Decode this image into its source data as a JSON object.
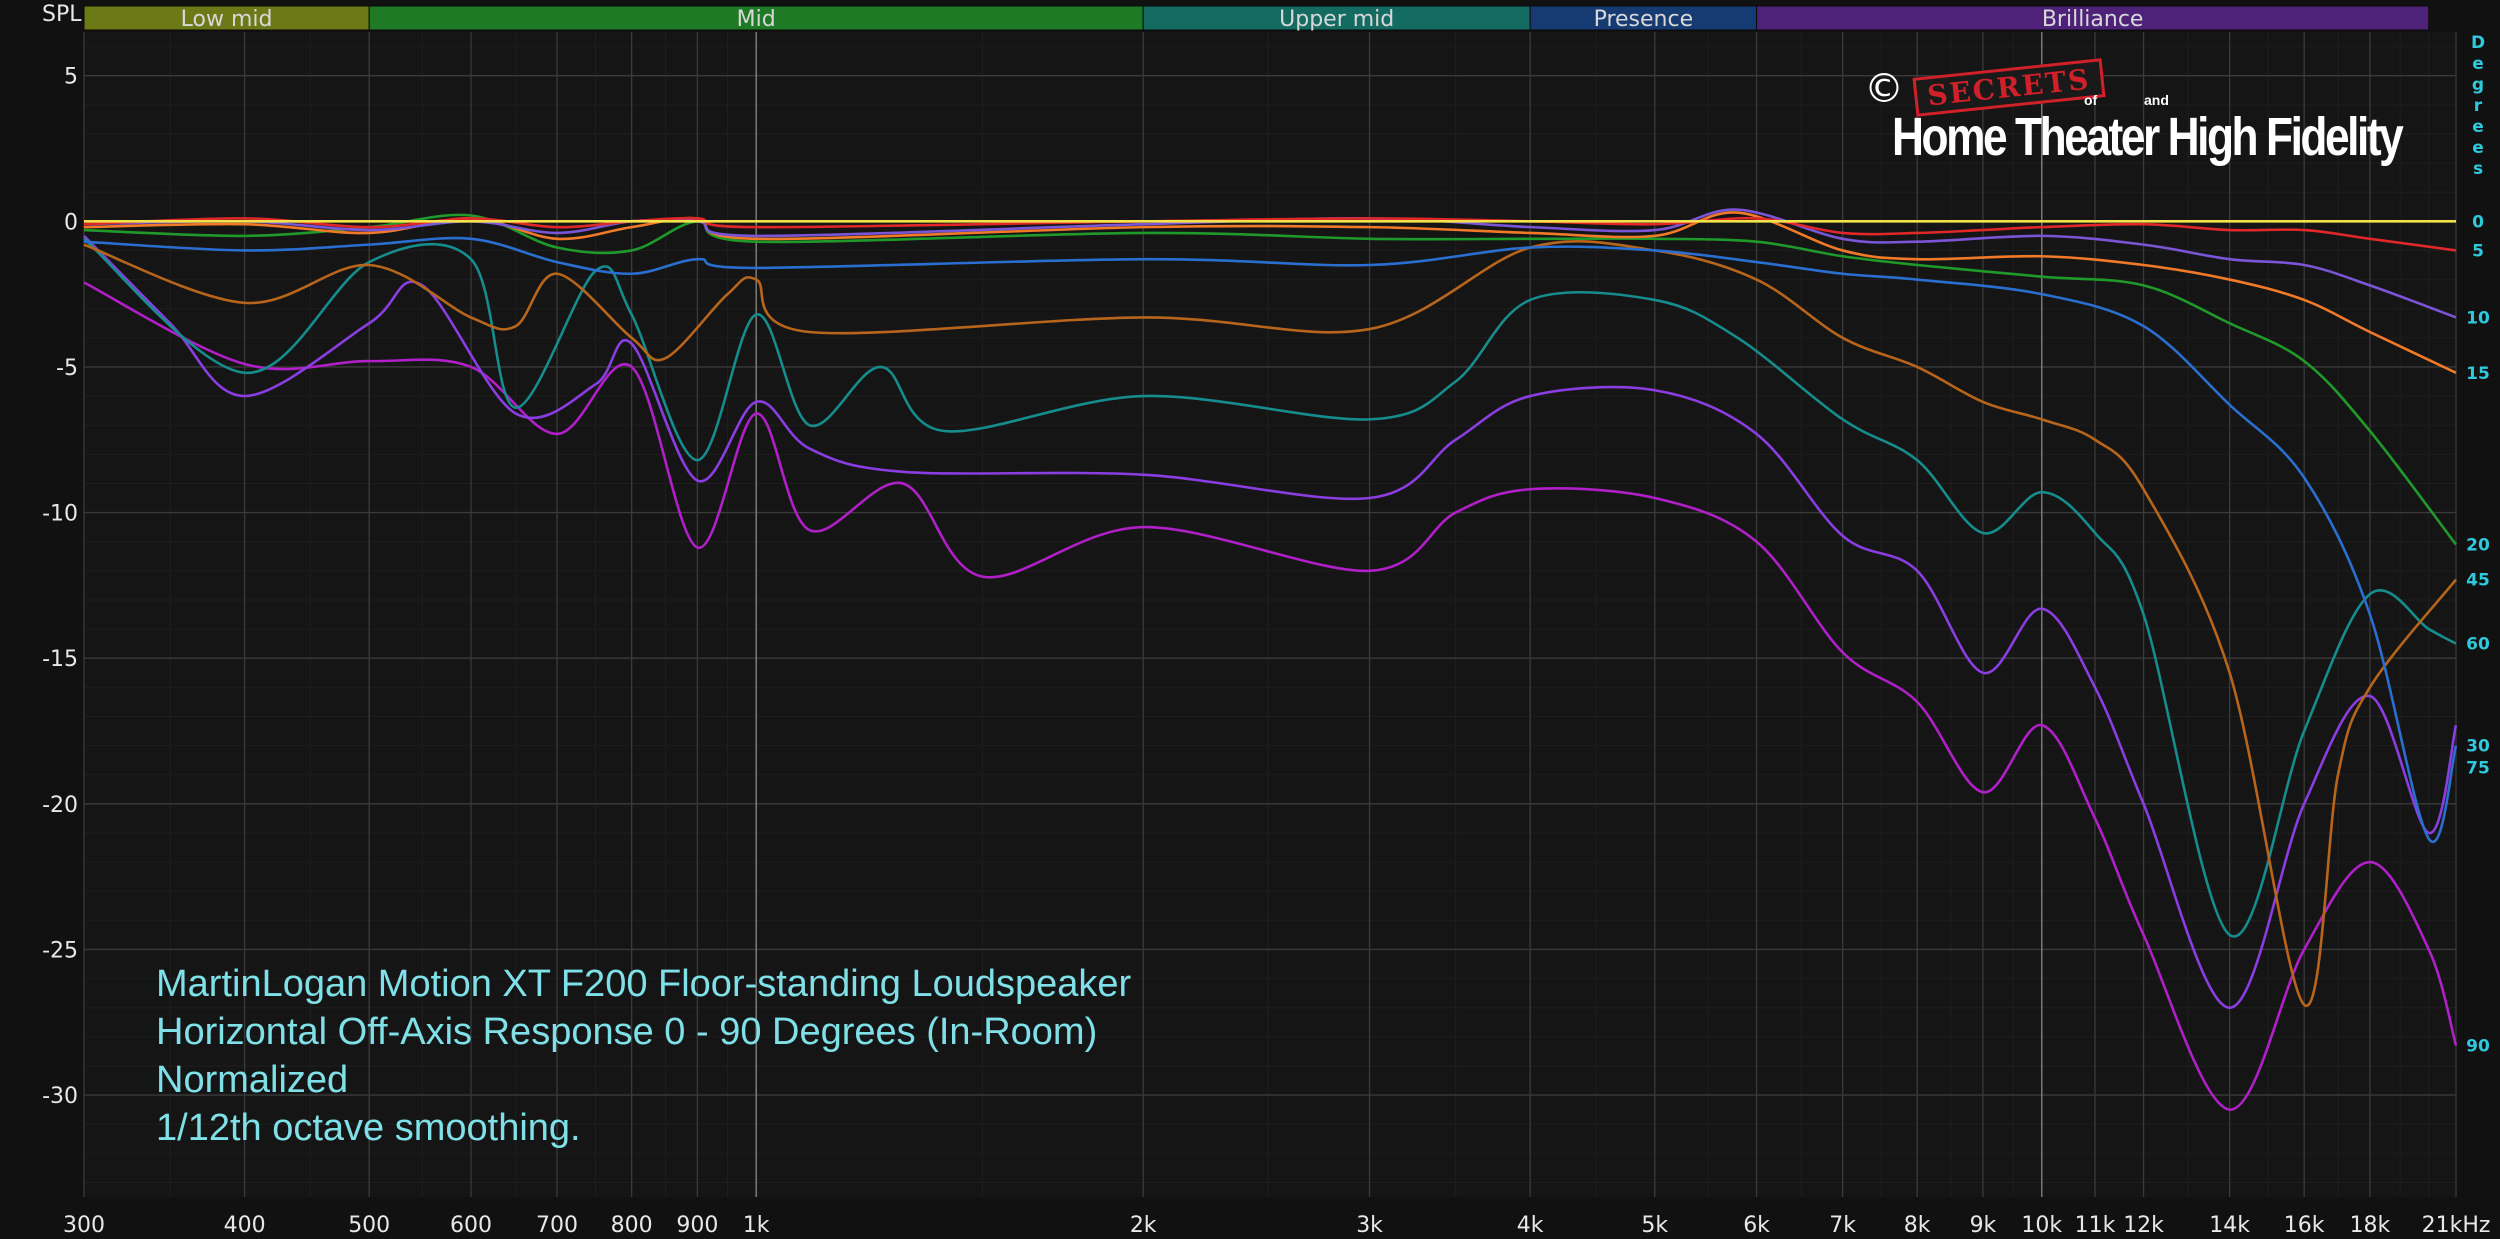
{
  "chart_data": {
    "type": "line",
    "title_lines": [
      "MartinLogan Motion XT F200 Floor-standing Loudspeaker",
      "Horizontal Off-Axis Response 0 - 90 Degrees (In-Room)",
      "Normalized",
      "1/12th octave smoothing."
    ],
    "ylabel": "SPL",
    "y2label": "Degrees",
    "x_scale": "log",
    "xlim": [
      300,
      21000
    ],
    "ylim": [
      -33.5,
      6.5
    ],
    "grid": true,
    "x_ticks": [
      {
        "v": 300,
        "label": "300"
      },
      {
        "v": 400,
        "label": "400"
      },
      {
        "v": 500,
        "label": "500"
      },
      {
        "v": 600,
        "label": "600"
      },
      {
        "v": 700,
        "label": "700"
      },
      {
        "v": 800,
        "label": "800"
      },
      {
        "v": 900,
        "label": "900"
      },
      {
        "v": 1000,
        "label": "1k"
      },
      {
        "v": 2000,
        "label": "2k"
      },
      {
        "v": 3000,
        "label": "3k"
      },
      {
        "v": 4000,
        "label": "4k"
      },
      {
        "v": 5000,
        "label": "5k"
      },
      {
        "v": 6000,
        "label": "6k"
      },
      {
        "v": 7000,
        "label": "7k"
      },
      {
        "v": 8000,
        "label": "8k"
      },
      {
        "v": 9000,
        "label": "9k"
      },
      {
        "v": 10000,
        "label": "10k"
      },
      {
        "v": 11000,
        "label": "11k",
        "dim": true
      },
      {
        "v": 12000,
        "label": "12k",
        "dim": true
      },
      {
        "v": 14000,
        "label": "14k"
      },
      {
        "v": 16000,
        "label": "16k",
        "dim": true
      },
      {
        "v": 18000,
        "label": "18k",
        "dim": true
      },
      {
        "v": 21000,
        "label": "21kHz"
      }
    ],
    "y_ticks": [
      5,
      0,
      -5,
      -10,
      -15,
      -20,
      -25,
      -30
    ],
    "bands": [
      {
        "label": "Low mid",
        "from": 300,
        "to": 500,
        "color": "#6b7a16"
      },
      {
        "label": "Mid",
        "from": 500,
        "to": 2000,
        "color": "#1f7a25"
      },
      {
        "label": "Upper mid",
        "from": 2000,
        "to": 4000,
        "color": "#136b62"
      },
      {
        "label": "Presence",
        "from": 4000,
        "to": 6000,
        "color": "#163a72"
      },
      {
        "label": "Brilliance",
        "from": 6000,
        "to": 20000,
        "color": "#4d2278"
      }
    ],
    "series": [
      {
        "name": "0",
        "color": "#f3e34a",
        "points": [
          [
            300,
            0
          ],
          [
            21000,
            0
          ]
        ]
      },
      {
        "name": "5",
        "color": "#e0282a",
        "points": [
          [
            300,
            -0.1
          ],
          [
            400,
            0.1
          ],
          [
            500,
            -0.2
          ],
          [
            600,
            0.1
          ],
          [
            700,
            -0.2
          ],
          [
            800,
            0
          ],
          [
            900,
            0.1
          ],
          [
            1000,
            -0.2
          ],
          [
            2000,
            0
          ],
          [
            3000,
            0.1
          ],
          [
            4000,
            0
          ],
          [
            5000,
            -0.1
          ],
          [
            6000,
            0.1
          ],
          [
            7000,
            -0.4
          ],
          [
            8000,
            -0.4
          ],
          [
            9000,
            -0.3
          ],
          [
            10000,
            -0.2
          ],
          [
            12000,
            -0.1
          ],
          [
            14000,
            -0.3
          ],
          [
            16000,
            -0.3
          ],
          [
            18000,
            -0.6
          ],
          [
            21000,
            -1.0
          ]
        ]
      },
      {
        "name": "10",
        "color": "#7a55d6",
        "points": [
          [
            300,
            -0.1
          ],
          [
            400,
            0
          ],
          [
            500,
            -0.3
          ],
          [
            600,
            0
          ],
          [
            700,
            -0.4
          ],
          [
            800,
            0
          ],
          [
            900,
            0
          ],
          [
            1000,
            -0.5
          ],
          [
            2000,
            -0.1
          ],
          [
            3000,
            0.1
          ],
          [
            4000,
            -0.2
          ],
          [
            5000,
            -0.3
          ],
          [
            5800,
            0.4
          ],
          [
            7000,
            -0.6
          ],
          [
            8000,
            -0.7
          ],
          [
            10000,
            -0.5
          ],
          [
            12000,
            -0.8
          ],
          [
            14000,
            -1.3
          ],
          [
            16000,
            -1.5
          ],
          [
            18000,
            -2.2
          ],
          [
            21000,
            -3.3
          ]
        ]
      },
      {
        "name": "15",
        "color": "#f07a28",
        "points": [
          [
            300,
            -0.2
          ],
          [
            400,
            -0.1
          ],
          [
            500,
            -0.4
          ],
          [
            600,
            0.1
          ],
          [
            700,
            -0.6
          ],
          [
            800,
            -0.2
          ],
          [
            900,
            0.1
          ],
          [
            1000,
            -0.6
          ],
          [
            2000,
            -0.2
          ],
          [
            3000,
            -0.2
          ],
          [
            4000,
            -0.4
          ],
          [
            5000,
            -0.5
          ],
          [
            5800,
            0.3
          ],
          [
            7000,
            -1.0
          ],
          [
            8000,
            -1.3
          ],
          [
            10000,
            -1.2
          ],
          [
            12000,
            -1.5
          ],
          [
            14000,
            -2.0
          ],
          [
            16000,
            -2.7
          ],
          [
            18000,
            -3.8
          ],
          [
            21000,
            -5.2
          ]
        ]
      },
      {
        "name": "20",
        "color": "#1f9a2a",
        "points": [
          [
            300,
            -0.3
          ],
          [
            400,
            -0.5
          ],
          [
            500,
            -0.2
          ],
          [
            600,
            0.2
          ],
          [
            700,
            -0.9
          ],
          [
            800,
            -1.0
          ],
          [
            900,
            0
          ],
          [
            1000,
            -0.7
          ],
          [
            2000,
            -0.4
          ],
          [
            3000,
            -0.6
          ],
          [
            4000,
            -0.6
          ],
          [
            5000,
            -0.6
          ],
          [
            6000,
            -0.7
          ],
          [
            7000,
            -1.2
          ],
          [
            8000,
            -1.5
          ],
          [
            10000,
            -1.9
          ],
          [
            12000,
            -2.2
          ],
          [
            14000,
            -3.5
          ],
          [
            16000,
            -4.8
          ],
          [
            18000,
            -7.2
          ],
          [
            21000,
            -11.1
          ]
        ]
      },
      {
        "name": "30",
        "color": "#2a6fd0",
        "points": [
          [
            300,
            -0.7
          ],
          [
            400,
            -1.0
          ],
          [
            500,
            -0.8
          ],
          [
            600,
            -0.6
          ],
          [
            700,
            -1.4
          ],
          [
            800,
            -1.8
          ],
          [
            900,
            -1.3
          ],
          [
            1000,
            -1.6
          ],
          [
            2000,
            -1.3
          ],
          [
            3000,
            -1.5
          ],
          [
            4000,
            -0.9
          ],
          [
            5000,
            -1.0
          ],
          [
            6000,
            -1.4
          ],
          [
            7000,
            -1.8
          ],
          [
            8000,
            -2.0
          ],
          [
            10000,
            -2.5
          ],
          [
            12000,
            -3.6
          ],
          [
            14000,
            -6.3
          ],
          [
            16000,
            -8.8
          ],
          [
            18000,
            -13.5
          ],
          [
            20000,
            -21.2
          ],
          [
            21000,
            -18.0
          ]
        ]
      },
      {
        "name": "45",
        "color": "#b8651c",
        "points": [
          [
            300,
            -0.8
          ],
          [
            400,
            -2.8
          ],
          [
            500,
            -1.5
          ],
          [
            600,
            -3.3
          ],
          [
            650,
            -3.6
          ],
          [
            700,
            -1.8
          ],
          [
            800,
            -4.0
          ],
          [
            850,
            -4.7
          ],
          [
            950,
            -2.5
          ],
          [
            1000,
            -2.0
          ],
          [
            1100,
            -3.8
          ],
          [
            2000,
            -3.3
          ],
          [
            3000,
            -3.7
          ],
          [
            4000,
            -0.9
          ],
          [
            5000,
            -1.0
          ],
          [
            6000,
            -2.0
          ],
          [
            7000,
            -4.0
          ],
          [
            8000,
            -5.0
          ],
          [
            9000,
            -6.2
          ],
          [
            10000,
            -6.8
          ],
          [
            11000,
            -7.5
          ],
          [
            12000,
            -9.2
          ],
          [
            14000,
            -15.5
          ],
          [
            16000,
            -26.9
          ],
          [
            17000,
            -19.0
          ],
          [
            18000,
            -16.0
          ],
          [
            21000,
            -12.3
          ]
        ]
      },
      {
        "name": "60",
        "color": "#168c8c",
        "points": [
          [
            300,
            -0.6
          ],
          [
            400,
            -5.2
          ],
          [
            500,
            -1.4
          ],
          [
            600,
            -1.3
          ],
          [
            650,
            -6.4
          ],
          [
            750,
            -1.7
          ],
          [
            800,
            -3.2
          ],
          [
            900,
            -8.2
          ],
          [
            1000,
            -3.2
          ],
          [
            1100,
            -7.0
          ],
          [
            1250,
            -5.0
          ],
          [
            1400,
            -7.2
          ],
          [
            2000,
            -6.0
          ],
          [
            3000,
            -6.8
          ],
          [
            3500,
            -5.5
          ],
          [
            4000,
            -2.7
          ],
          [
            5000,
            -2.7
          ],
          [
            5800,
            -4.0
          ],
          [
            7000,
            -6.8
          ],
          [
            8000,
            -8.2
          ],
          [
            9000,
            -10.7
          ],
          [
            10000,
            -9.3
          ],
          [
            11000,
            -10.7
          ],
          [
            12000,
            -13.5
          ],
          [
            14000,
            -24.5
          ],
          [
            16000,
            -17.5
          ],
          [
            18000,
            -12.8
          ],
          [
            20000,
            -14.0
          ],
          [
            21000,
            -14.5
          ]
        ]
      },
      {
        "name": "75",
        "color": "#8a3de0",
        "points": [
          [
            300,
            -0.5
          ],
          [
            350,
            -3.5
          ],
          [
            400,
            -6.0
          ],
          [
            500,
            -3.5
          ],
          [
            550,
            -2.2
          ],
          [
            650,
            -6.6
          ],
          [
            750,
            -5.6
          ],
          [
            800,
            -4.2
          ],
          [
            900,
            -8.9
          ],
          [
            1000,
            -6.2
          ],
          [
            1100,
            -7.8
          ],
          [
            1300,
            -8.6
          ],
          [
            2000,
            -8.7
          ],
          [
            3000,
            -9.5
          ],
          [
            3500,
            -7.5
          ],
          [
            4000,
            -6.0
          ],
          [
            5000,
            -5.8
          ],
          [
            6000,
            -7.3
          ],
          [
            7000,
            -10.8
          ],
          [
            8000,
            -12.0
          ],
          [
            9000,
            -15.5
          ],
          [
            10000,
            -13.3
          ],
          [
            11000,
            -16.0
          ],
          [
            12000,
            -20.0
          ],
          [
            14000,
            -27.0
          ],
          [
            16000,
            -20.0
          ],
          [
            18000,
            -16.3
          ],
          [
            20000,
            -21.0
          ],
          [
            21000,
            -17.3
          ]
        ]
      },
      {
        "name": "90",
        "color": "#b01fc8",
        "points": [
          [
            300,
            -2.1
          ],
          [
            400,
            -4.9
          ],
          [
            500,
            -4.8
          ],
          [
            600,
            -5.0
          ],
          [
            700,
            -7.3
          ],
          [
            800,
            -5.0
          ],
          [
            900,
            -11.2
          ],
          [
            1000,
            -6.6
          ],
          [
            1100,
            -10.6
          ],
          [
            1300,
            -9.0
          ],
          [
            1500,
            -12.2
          ],
          [
            2000,
            -10.5
          ],
          [
            3000,
            -12.0
          ],
          [
            3500,
            -10.0
          ],
          [
            4000,
            -9.2
          ],
          [
            5000,
            -9.5
          ],
          [
            6000,
            -11.0
          ],
          [
            7000,
            -14.8
          ],
          [
            8000,
            -16.5
          ],
          [
            9000,
            -19.6
          ],
          [
            10000,
            -17.3
          ],
          [
            11000,
            -20.5
          ],
          [
            12000,
            -24.5
          ],
          [
            14000,
            -30.5
          ],
          [
            16000,
            -25.0
          ],
          [
            18000,
            -22.0
          ],
          [
            20000,
            -25.0
          ],
          [
            21000,
            -28.3
          ]
        ]
      }
    ]
  },
  "logo": {
    "copyright": "©",
    "secrets": "SECRETS",
    "of": "of",
    "and": "and",
    "name": "Home Theater High Fidelity"
  }
}
